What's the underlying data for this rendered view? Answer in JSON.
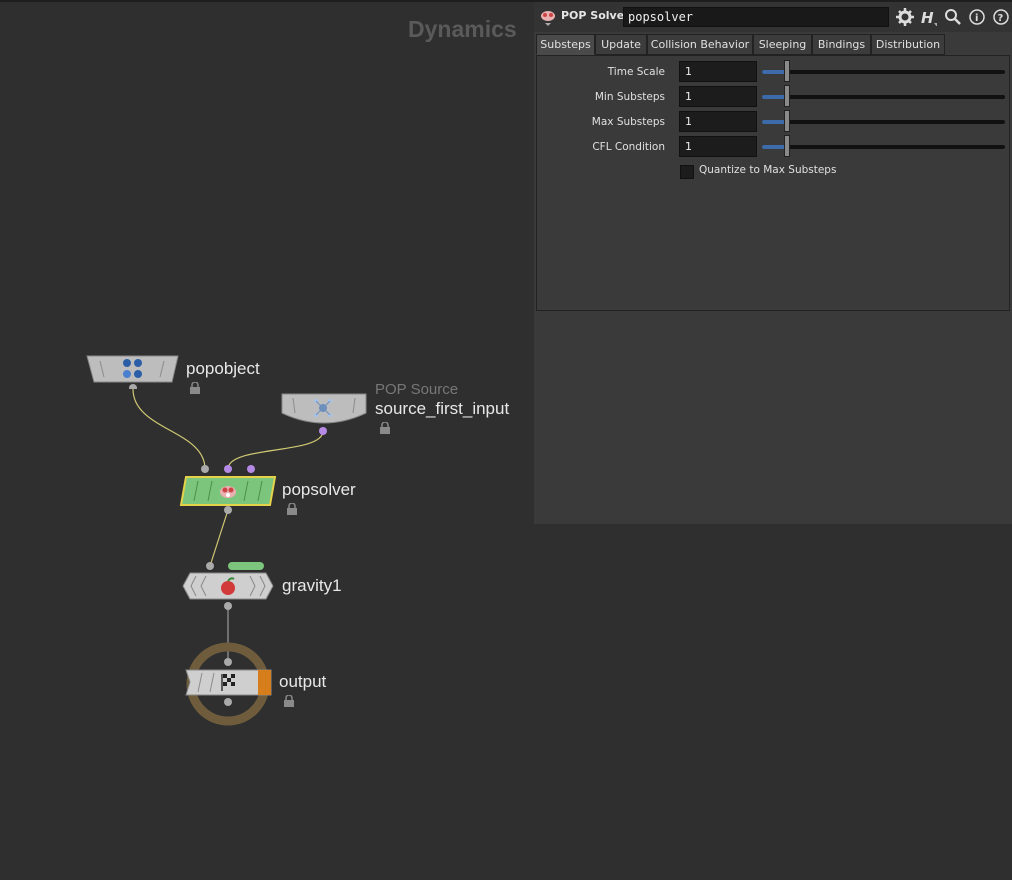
{
  "network": {
    "context_label": "Dynamics",
    "nodes": {
      "popobject": {
        "name": "popobject"
      },
      "popsource": {
        "type_label": "POP Source",
        "name": "source_first_input"
      },
      "popsolver": {
        "name": "popsolver"
      },
      "gravity": {
        "name": "gravity1"
      },
      "output": {
        "name": "output"
      }
    }
  },
  "parameters": {
    "op_type": "POP Solver",
    "node_name": "popsolver",
    "header_icons": [
      "gear-icon",
      "houdini-help-icon",
      "search-icon",
      "info-icon",
      "help-icon"
    ],
    "tabs": [
      "Substeps",
      "Update",
      "Collision Behavior",
      "Sleeping",
      "Bindings",
      "Distribution"
    ],
    "active_tab": "Substeps",
    "fields": [
      {
        "label": "Time Scale",
        "value": "1"
      },
      {
        "label": "Min Substeps",
        "value": "1"
      },
      {
        "label": "Max Substeps",
        "value": "1"
      },
      {
        "label": "CFL Condition",
        "value": "1"
      }
    ],
    "checkbox": {
      "label": "Quantize to Max Substeps",
      "checked": false
    }
  },
  "colors": {
    "background": "#2f2f2f",
    "selected_node": "#7cc57c",
    "selected_outline": "#e6d24a",
    "wire_yellow": "#cfc873",
    "input_purple": "#b58ae6",
    "output_flag": "#d67d1c",
    "display_ring": "#6e5c3d",
    "slider_fill": "#3d6aa8"
  }
}
